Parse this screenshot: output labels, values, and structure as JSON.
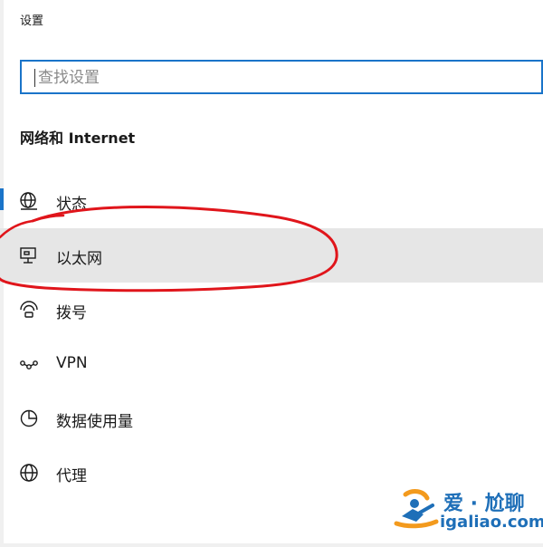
{
  "window": {
    "title": "设置"
  },
  "search": {
    "value": "",
    "placeholder": "查找设置"
  },
  "section": {
    "title": "网络和 Internet"
  },
  "nav": {
    "items": [
      {
        "label": "状态",
        "icon": "globe-status-icon",
        "state": "active"
      },
      {
        "label": "以太网",
        "icon": "ethernet-icon",
        "state": "hover"
      },
      {
        "label": "拨号",
        "icon": "dial-up-icon",
        "state": "normal"
      },
      {
        "label": "VPN",
        "icon": "vpn-icon",
        "state": "normal"
      },
      {
        "label": "数据使用量",
        "icon": "data-usage-icon",
        "state": "normal"
      },
      {
        "label": "代理",
        "icon": "globe-proxy-icon",
        "state": "normal"
      }
    ]
  },
  "watermark": {
    "name": "爱 · 尬聊",
    "url": "igaliao.com"
  },
  "colors": {
    "accent": "#1a74c9",
    "hover": "#e6e6e6",
    "annotation": "#e0151b",
    "watermark_blue": "#1e6fb8",
    "watermark_orange": "#f39a1d"
  }
}
